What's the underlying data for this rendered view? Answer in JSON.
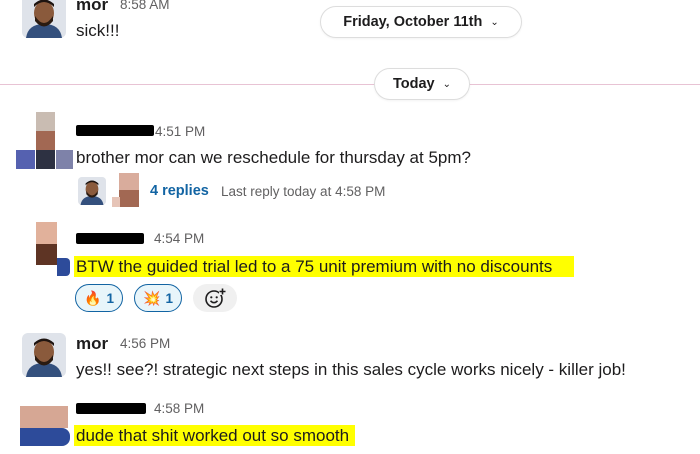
{
  "date_dividers": {
    "friday": "Friday, October 11th",
    "today": "Today"
  },
  "messages": [
    {
      "user": "mor",
      "time": "8:58 AM",
      "text": "sick!!!"
    },
    {
      "user": "",
      "time": "4:51 PM",
      "text": "brother mor can we reschedule for thursday at 5pm?"
    },
    {
      "user": "",
      "time": "4:54 PM",
      "text": "BTW the guided trial led to a 75 unit premium with no discounts"
    },
    {
      "user": "mor",
      "time": "4:56 PM",
      "text": "yes!! see?! strategic next steps in this sales cycle works nicely - killer job!"
    },
    {
      "user": "",
      "time": "4:58 PM",
      "text": "dude that shit worked out so smooth"
    }
  ],
  "thread": {
    "replies": "4 replies",
    "last_reply": "Last reply today at 4:58 PM"
  },
  "reactions": [
    {
      "icon": "fire-emoji",
      "glyph": "🔥",
      "count": "1"
    },
    {
      "icon": "collision-emoji",
      "glyph": "💥",
      "count": "1"
    }
  ],
  "colors": {
    "highlight": "#ffff00",
    "link": "#1264a3",
    "divider": "#e8c3d4"
  }
}
